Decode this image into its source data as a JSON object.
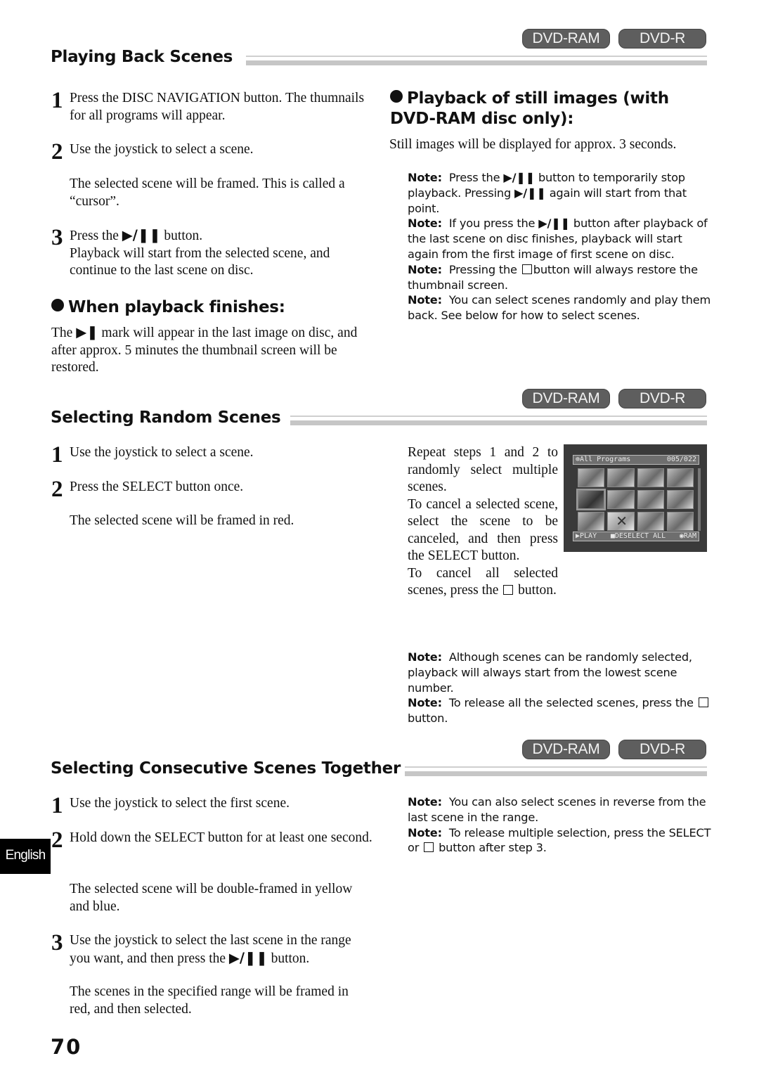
{
  "badges": {
    "ram": "DVD-RAM",
    "r": "DVD-R"
  },
  "glyphs": {
    "play_pause": "▶/❚❚",
    "end_mark": "▶❚",
    "stop": "stop-square"
  },
  "playing_back": {
    "title": "Playing Back Scenes",
    "steps": [
      {
        "num": "1",
        "text": "Press the DISC NAVIGATION button. The thumnails for all programs will appear."
      },
      {
        "num": "2",
        "text": "Use the joystick to select a scene."
      },
      {
        "num": "3",
        "text_before": "Press the",
        "text_after": "button.",
        "text2": "Playback will start from the selected scene, and continue to the last scene on disc."
      }
    ],
    "step2_detail": "The selected scene will be framed. This is called a “cursor”.",
    "finish": {
      "heading": "When playback finishes:",
      "text_before": "The",
      "text_after": "mark will appear in the last image on disc, and after approx. 5 minutes the thumbnail screen will be restored."
    },
    "still": {
      "heading": "Playback of still images (with DVD-RAM disc only):",
      "text": "Still images will be displayed for approx. 3 seconds."
    },
    "notes": [
      {
        "label": "Note:",
        "pre": "Press the",
        "mid": "button to temporarily stop playback. Pressing",
        "post": "again will start from that point."
      },
      {
        "label": "Note:",
        "pre": "If you press the",
        "post": "button after playback of the last scene on disc finishes, playback will start again from the first image of first scene on disc."
      },
      {
        "label": "Note:",
        "pre": "Pressing the",
        "post": "button will always restore the thumbnail screen."
      },
      {
        "label": "Note:",
        "text": "You can select scenes randomly and play them back. See below for how to select scenes."
      }
    ]
  },
  "random": {
    "title": "Selecting Random Scenes",
    "steps": [
      {
        "num": "1",
        "text": "Use the joystick to select a scene."
      },
      {
        "num": "2",
        "text": "Press the SELECT button once."
      }
    ],
    "step2_detail": "The selected scene will be framed in red.",
    "side_text": {
      "p1": "Repeat steps 1 and 2 to randomly select multiple scenes.",
      "p2": "To cancel a selected scene, select the scene to be canceled, and then press the SELECT button.",
      "p3_before": "To cancel all selected scenes, press the",
      "p3_after": "button."
    },
    "screen": {
      "header_left": "⊕All Programs",
      "header_right": "005/022",
      "footer_play": "▶PLAY",
      "footer_deselect": "■DESELECT ALL",
      "footer_media": "◉RAM"
    },
    "notes": [
      {
        "label": "Note:",
        "text": "Although scenes can be randomly selected, playback will always start from the lowest scene number."
      },
      {
        "label": "Note:",
        "pre": "To release all the selected scenes, press the",
        "post": "button."
      }
    ]
  },
  "consecutive": {
    "title": "Selecting Consecutive Scenes Together",
    "steps": [
      {
        "num": "1",
        "text": "Use the joystick to select the first scene."
      },
      {
        "num": "2",
        "text": "Hold down the SELECT button for at least one second."
      },
      {
        "num": "3",
        "text_before": "Use the joystick to select the last scene in the range you want, and then press the",
        "text_after": "button."
      }
    ],
    "step2_detail": "The selected scene will be double-framed in yellow and blue.",
    "step3_detail": "The scenes in the specified range will be framed in red, and then selected.",
    "notes": [
      {
        "label": "Note:",
        "text": "You can also select scenes in reverse from the last scene in the range."
      },
      {
        "label": "Note:",
        "pre": "To release multiple selection, press the SELECT or",
        "post": "button after step 3."
      }
    ]
  },
  "language_tab": "English",
  "page_number": "70"
}
